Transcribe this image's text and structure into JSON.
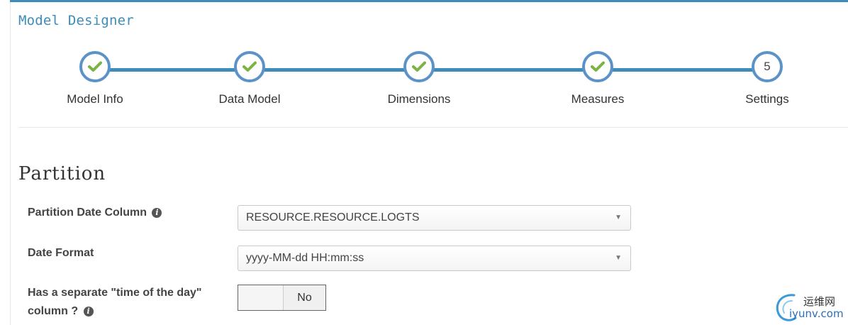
{
  "app": {
    "title": "Model Designer"
  },
  "wizard": {
    "steps": [
      {
        "label": "Model Info",
        "status": "complete",
        "icon": "check-icon"
      },
      {
        "label": "Data Model",
        "status": "complete",
        "icon": "check-icon"
      },
      {
        "label": "Dimensions",
        "status": "complete",
        "icon": "check-icon"
      },
      {
        "label": "Measures",
        "status": "complete",
        "icon": "check-icon"
      },
      {
        "label": "Settings",
        "status": "current",
        "number": "5"
      }
    ]
  },
  "section": {
    "title": "Partition"
  },
  "form": {
    "partition_date_column": {
      "label": "Partition Date Column",
      "value": "RESOURCE.RESOURCE.LOGTS"
    },
    "date_format": {
      "label": "Date Format",
      "value": "yyyy-MM-dd HH:mm:ss"
    },
    "separate_time": {
      "label_line1": "Has a separate \"time of the day\"",
      "label_line2": "column ?",
      "toggle_value": "No"
    }
  },
  "watermark": {
    "cn_text": "运维网",
    "url_text": "iyunv.com"
  },
  "colors": {
    "accent": "#3c8dbc",
    "check": "#7cb342",
    "step_border": "#5b93c8"
  }
}
